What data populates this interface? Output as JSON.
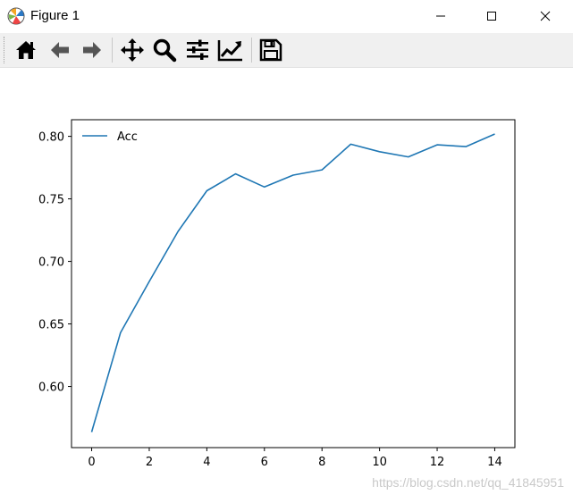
{
  "window": {
    "title": "Figure 1"
  },
  "toolbar": {
    "buttons": [
      {
        "name": "home-icon",
        "tooltip": "Home"
      },
      {
        "name": "back-arrow-icon",
        "tooltip": "Back"
      },
      {
        "name": "forward-arrow-icon",
        "tooltip": "Forward"
      },
      {
        "name": "pan-icon",
        "tooltip": "Pan"
      },
      {
        "name": "zoom-icon",
        "tooltip": "Zoom"
      },
      {
        "name": "subplots-icon",
        "tooltip": "Subplots"
      },
      {
        "name": "customize-icon",
        "tooltip": "Customize"
      },
      {
        "name": "save-icon",
        "tooltip": "Save"
      }
    ]
  },
  "chart_data": {
    "type": "line",
    "title": "",
    "xlabel": "",
    "ylabel": "",
    "x": [
      0,
      1,
      2,
      3,
      4,
      5,
      6,
      7,
      8,
      9,
      10,
      11,
      12,
      13,
      14
    ],
    "series": [
      {
        "name": "Acc",
        "color": "#1f77b4",
        "values": [
          0.5635,
          0.643,
          0.684,
          0.724,
          0.7565,
          0.77,
          0.7595,
          0.769,
          0.7732,
          0.7937,
          0.7877,
          0.7836,
          0.7932,
          0.7918,
          0.8019
        ]
      }
    ],
    "xlim": [
      -0.7,
      14.7
    ],
    "ylim": [
      0.5511,
      0.8133
    ],
    "xticks": [
      0,
      2,
      4,
      6,
      8,
      10,
      12,
      14
    ],
    "xtick_labels": [
      "0",
      "2",
      "4",
      "6",
      "8",
      "10",
      "12",
      "14"
    ],
    "yticks": [
      0.6,
      0.65,
      0.7,
      0.75,
      0.8
    ],
    "ytick_labels": [
      "0.60",
      "0.65",
      "0.70",
      "0.75",
      "0.80"
    ],
    "grid": false,
    "legend": "top-left"
  },
  "watermark": "https://blog.csdn.net/qq_41845951"
}
